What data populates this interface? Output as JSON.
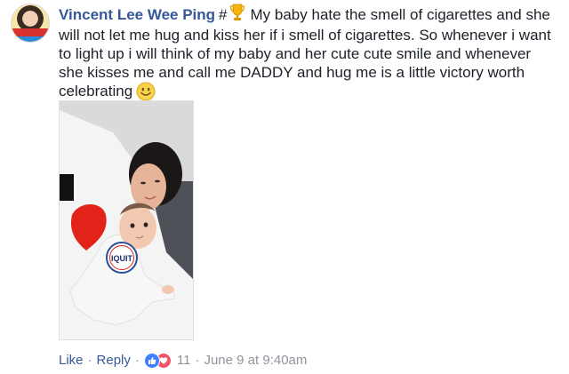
{
  "comment": {
    "author": "Vincent Lee Wee Ping",
    "hash": "#",
    "text": "My baby hate the smell of cigarettes and she will not let me hug and kiss her if i smell of cigarettes. So whenever i want to light up i will think of my baby and her cute cute smile and whenever she kisses me and call me DADDY and hug me is a little victory worth celebrating"
  },
  "photo": {
    "shirt_badge": "IQUIT"
  },
  "actions": {
    "like": "Like",
    "reply": "Reply",
    "reaction_count": "11",
    "timestamp": "June 9 at 9:40am"
  },
  "icons": {
    "trophy": "trophy-icon",
    "smiley": "smiley-emoji-icon",
    "like": "like-reaction-icon",
    "love": "love-reaction-icon"
  },
  "colors": {
    "author": "#365899",
    "link": "#365899",
    "meta": "#90949c",
    "like_reaction": "#4080ff",
    "love_reaction": "#f25268"
  }
}
